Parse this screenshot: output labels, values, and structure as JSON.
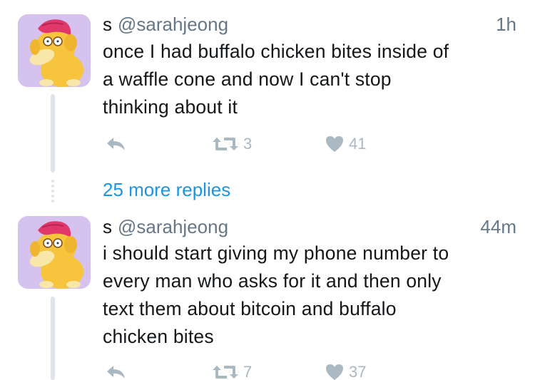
{
  "tweets": [
    {
      "display_name": "s",
      "handle": "@sarahjeong",
      "timestamp": "1h",
      "text_lines": [
        "once I had buffalo chicken bites inside of",
        "a waffle cone and now I can't stop",
        "thinking about it"
      ],
      "retweets": "3",
      "likes": "41"
    },
    {
      "display_name": "s",
      "handle": "@sarahjeong",
      "timestamp": "44m",
      "text_lines": [
        "i should start giving my phone number to",
        "every man who asks for it and then only",
        "text them about bitcoin and buffalo",
        "chicken bites"
      ],
      "retweets": "7",
      "likes": "37"
    }
  ],
  "more_replies": "25 more replies",
  "icons": {
    "reply": "reply-icon",
    "retweet": "retweet-icon",
    "like": "heart-icon",
    "avatar": "psyduck-avatar"
  },
  "colors": {
    "link": "#1b95e0",
    "muted": "#657786",
    "action_gray": "#aab8c2",
    "avatar_bg": "#d5c2ef"
  }
}
